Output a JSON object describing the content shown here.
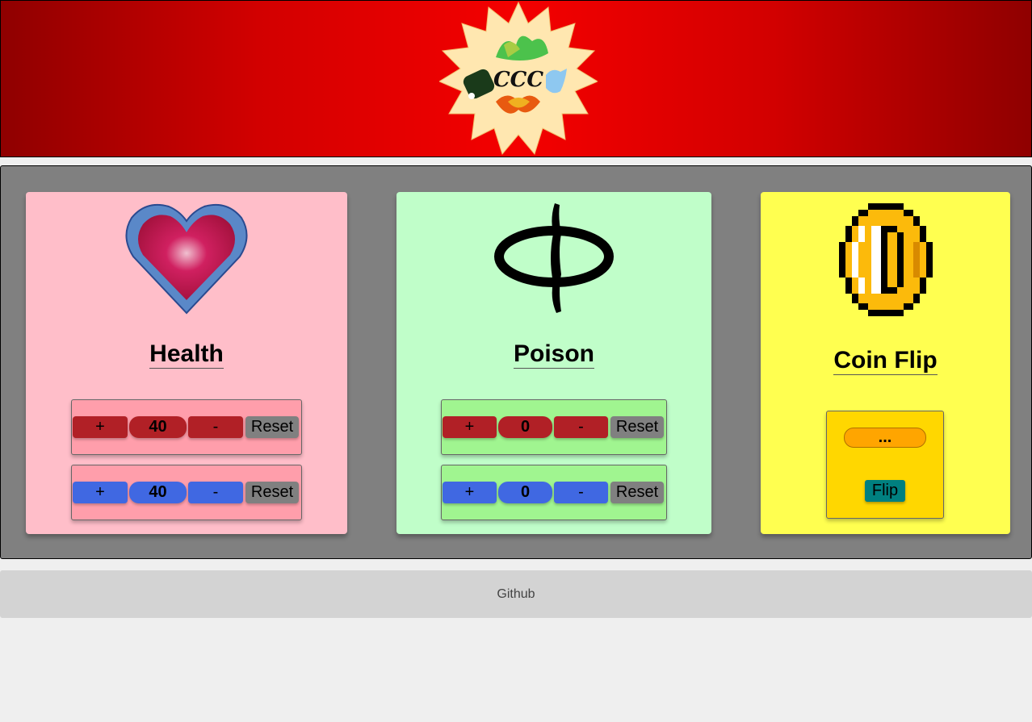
{
  "header": {
    "logo_text": "CCC",
    "logo_icon": "ccc-sun-logo"
  },
  "cards": {
    "health": {
      "title": "Health",
      "icon": "heart-container-icon",
      "counters": [
        {
          "plus": "+",
          "value": "40",
          "minus": "-",
          "reset": "Reset",
          "color": "#b12026"
        },
        {
          "plus": "+",
          "value": "40",
          "minus": "-",
          "reset": "Reset",
          "color": "#4068e2"
        }
      ]
    },
    "poison": {
      "title": "Poison",
      "icon": "phyrexian-phi-icon",
      "counters": [
        {
          "plus": "+",
          "value": "0",
          "minus": "-",
          "reset": "Reset",
          "color": "#b12026"
        },
        {
          "plus": "+",
          "value": "0",
          "minus": "-",
          "reset": "Reset",
          "color": "#4068e2"
        }
      ]
    },
    "coin": {
      "title": "Coin Flip",
      "icon": "pixel-coin-icon",
      "result": "...",
      "flip_label": "Flip"
    }
  },
  "footer": {
    "link": "Github"
  },
  "colors": {
    "header_red": "#f40000",
    "health_bg": "#ffbec9",
    "poison_bg": "#c0fec9",
    "coin_bg": "#ffff50",
    "reset_gray": "#808080",
    "flip_teal": "#008080",
    "result_orange": "#ffa500"
  }
}
